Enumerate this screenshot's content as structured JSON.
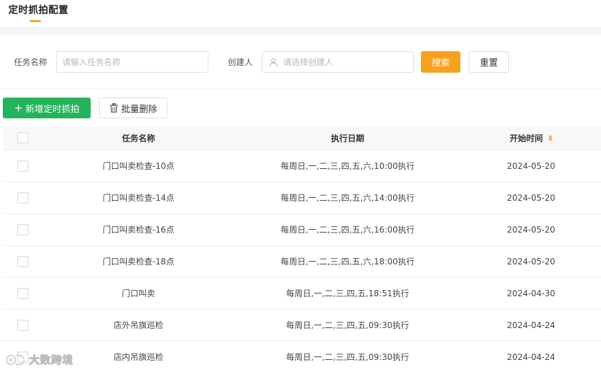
{
  "header": {
    "title": "定时抓拍配置"
  },
  "search": {
    "task_name_label": "任务名称",
    "task_name_placeholder": "请输入任务名称",
    "creator_label": "创建人",
    "creator_placeholder": "请选择创建人",
    "search_label": "搜索",
    "reset_label": "重置"
  },
  "toolbar": {
    "add_label": "新增定时抓拍",
    "batch_delete_label": "批量删除"
  },
  "table": {
    "columns": {
      "name": "任务名称",
      "date": "执行日期",
      "time": "开始时间"
    },
    "rows": [
      {
        "name": "门口叫卖检查-10点",
        "date": "每周日,一,二,三,四,五,六,10:00执行",
        "time": "2024-05-20"
      },
      {
        "name": "门口叫卖检查-14点",
        "date": "每周日,一,二,三,四,五,六,14:00执行",
        "time": "2024-05-20"
      },
      {
        "name": "门口叫卖检查-16点",
        "date": "每周日,一,二,三,四,五,六,16:00执行",
        "time": "2024-05-20"
      },
      {
        "name": "门口叫卖检查-18点",
        "date": "每周日,一,二,三,四,五,六,18:00执行",
        "time": "2024-05-20"
      },
      {
        "name": "门口叫卖",
        "date": "每周日,一,二,三,四,五,18:51执行",
        "time": "2024-04-30"
      },
      {
        "name": "店外吊旗巡检",
        "date": "每周日,一,二,三,四,五,09:30执行",
        "time": "2024-04-24"
      },
      {
        "name": "店内吊旗巡检",
        "date": "每周日,一,二,三,四,五,09:30执行",
        "time": "2024-04-24"
      }
    ]
  },
  "watermark": {
    "text": "大数跨境"
  },
  "colors": {
    "accent": "#f7a21b",
    "add": "#23b35a",
    "border": "#dcdfe6"
  },
  "icons": {
    "creator": "user-icon",
    "add": "plus-icon",
    "batch": "trash-icon",
    "sort": "sort-icon"
  }
}
